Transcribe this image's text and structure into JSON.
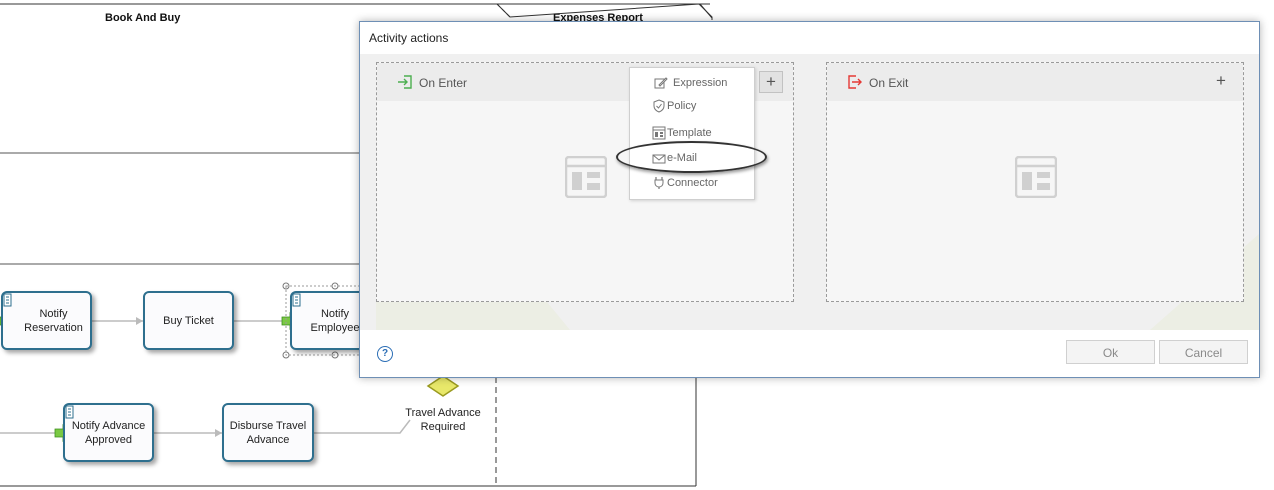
{
  "diagram": {
    "lanes": [
      {
        "title": "Book And Buy"
      },
      {
        "title": "Expenses Report"
      }
    ],
    "tasks": [
      {
        "label": "Notify Reservation"
      },
      {
        "label": "Buy Ticket"
      },
      {
        "label": "Notify Employee"
      },
      {
        "label": "Notify Advance Approved"
      },
      {
        "label": "Disburse Travel Advance"
      }
    ],
    "gateway": {
      "label": "Travel Advance Required"
    }
  },
  "dialog": {
    "title": "Activity actions",
    "on_enter": {
      "title": "On Enter",
      "icon": "enter-icon",
      "add_label": "+"
    },
    "on_exit": {
      "title": "On Exit",
      "icon": "exit-icon",
      "add_label": "+"
    },
    "menu": {
      "items": [
        {
          "label": "Expression",
          "icon": "expression-icon"
        },
        {
          "label": "Policy",
          "icon": "policy-icon"
        },
        {
          "label": "Template",
          "icon": "template-icon"
        },
        {
          "label": "e-Mail",
          "icon": "mail-icon",
          "highlighted": true
        },
        {
          "label": "Connector",
          "icon": "connector-icon"
        }
      ]
    },
    "help_label": "?",
    "ok_label": "Ok",
    "cancel_label": "Cancel"
  },
  "colors": {
    "task_border": "#2e6f8e",
    "enter_icon": "#4caf50",
    "exit_icon": "#e53935",
    "help": "#2a6db5",
    "dialog_border": "#6e8fb5"
  }
}
